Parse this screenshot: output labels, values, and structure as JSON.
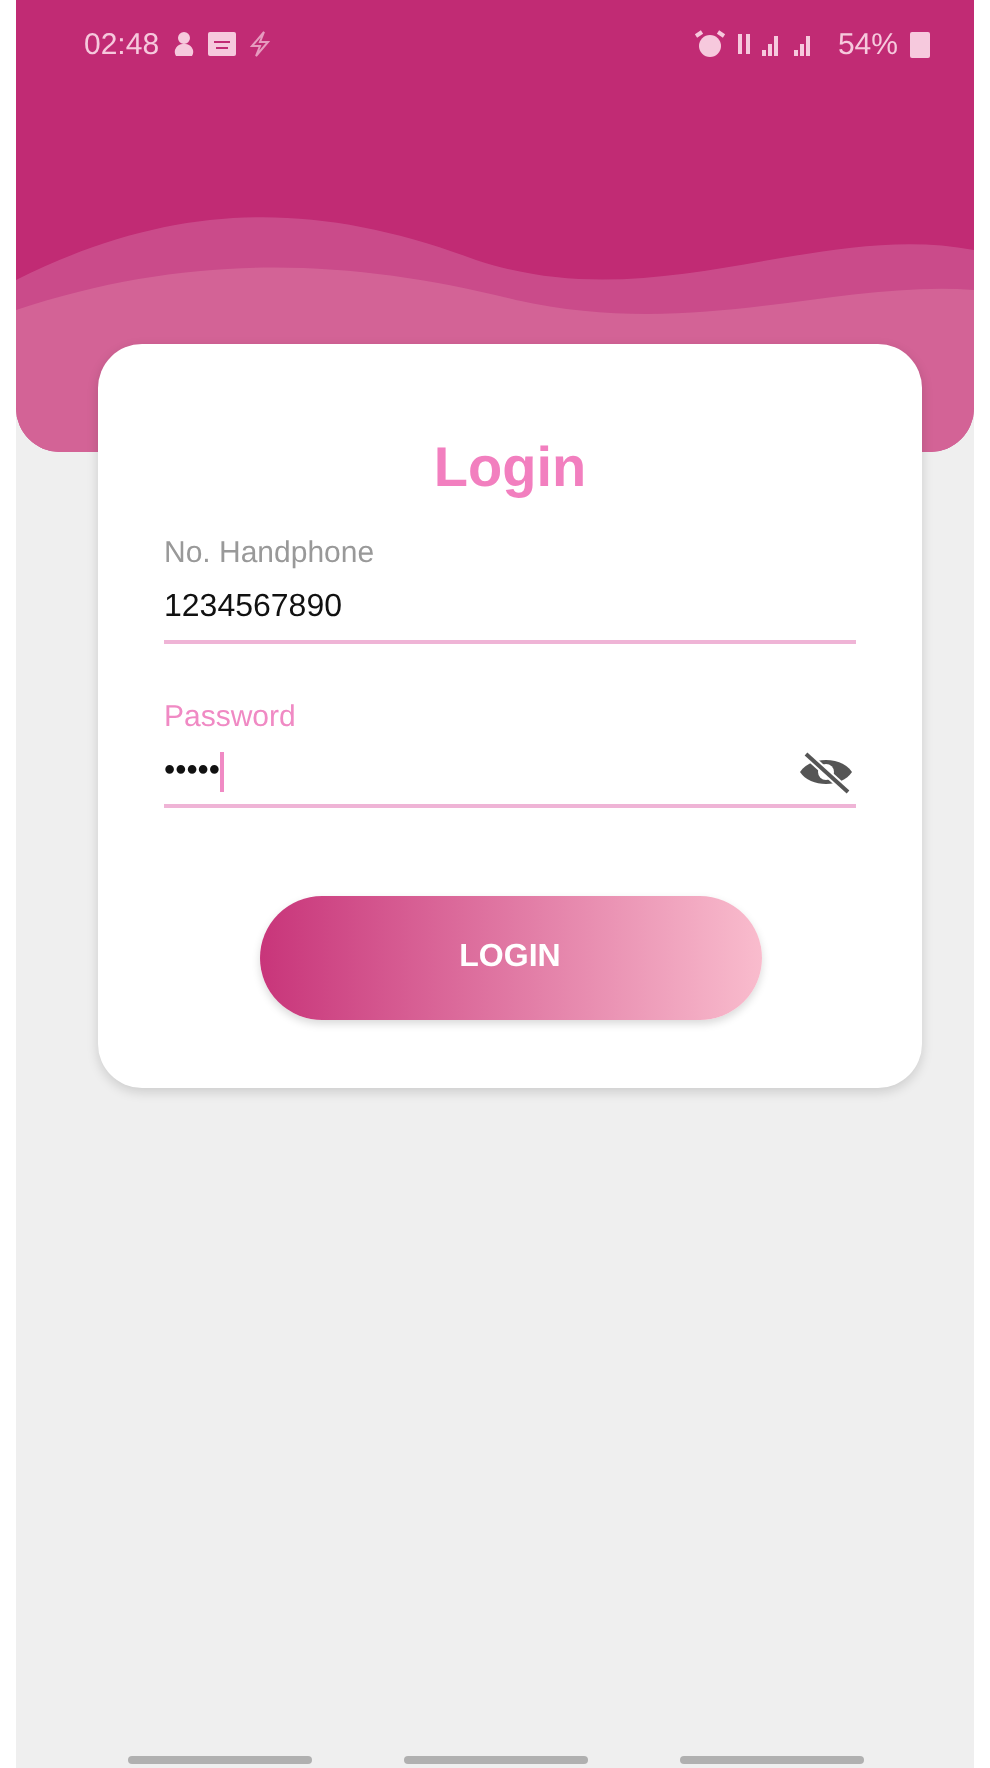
{
  "status_bar": {
    "time": "02:48",
    "battery": "54%"
  },
  "login": {
    "title": "Login",
    "fields": [
      {
        "label": "No. Handphone",
        "value": "1234567890",
        "focused": false,
        "kind": "text"
      },
      {
        "label": "Password",
        "value": "•••••",
        "focused": true,
        "kind": "password"
      }
    ],
    "button": "LOGIN"
  }
}
